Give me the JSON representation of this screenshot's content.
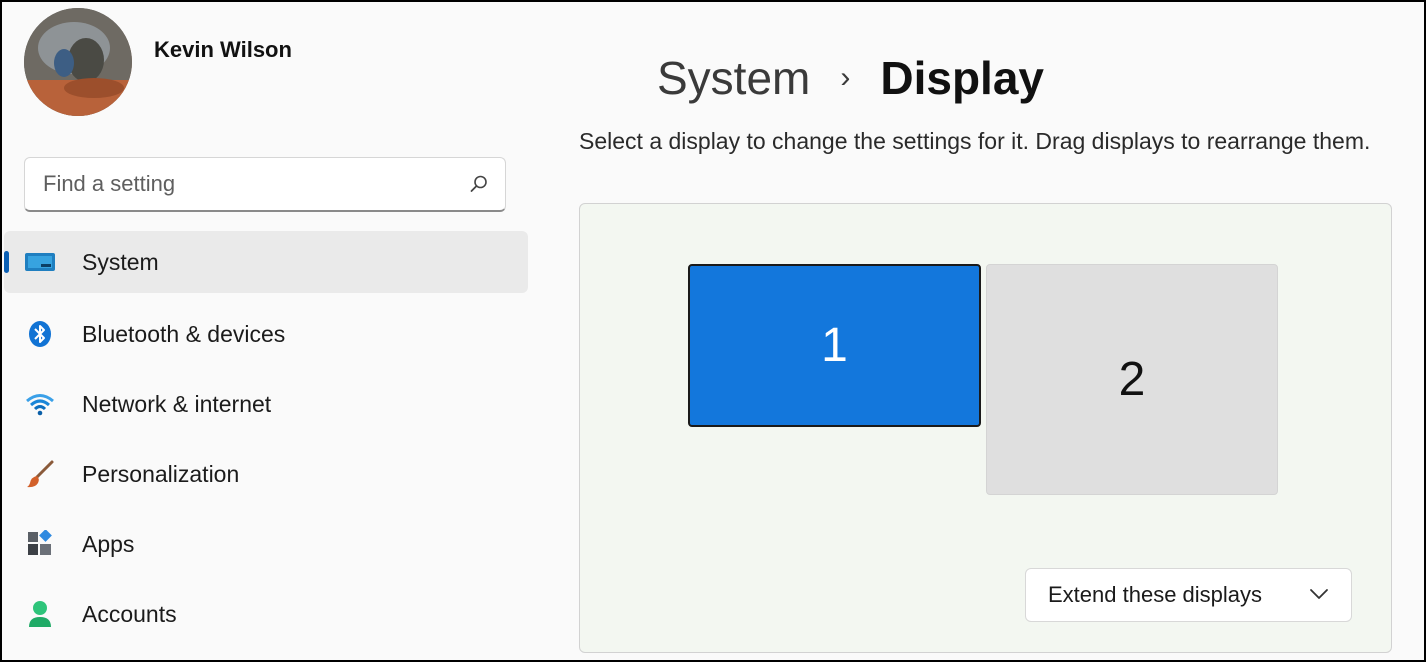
{
  "profile": {
    "name": "Kevin Wilson"
  },
  "search": {
    "placeholder": "Find a setting",
    "icon": "search-icon"
  },
  "sidebar": {
    "items": [
      {
        "label": "System",
        "icon": "system-display-icon",
        "selected": true
      },
      {
        "label": "Bluetooth & devices",
        "icon": "bluetooth-icon"
      },
      {
        "label": "Network & internet",
        "icon": "wifi-icon"
      },
      {
        "label": "Personalization",
        "icon": "paintbrush-icon"
      },
      {
        "label": "Apps",
        "icon": "apps-icon"
      },
      {
        "label": "Accounts",
        "icon": "person-icon"
      }
    ]
  },
  "header": {
    "parent": "System",
    "separator": "›",
    "current": "Display"
  },
  "main": {
    "description": "Select a display to change the settings for it. Drag displays to rearrange them.",
    "displays": [
      {
        "label": "1",
        "selected": true
      },
      {
        "label": "2",
        "selected": false
      }
    ],
    "mode_select": {
      "value": "Extend these displays"
    }
  },
  "colors": {
    "accent": "#1377dc",
    "selection_bar": "#0a5fb4",
    "panel_bg": "#f3f7f1"
  }
}
